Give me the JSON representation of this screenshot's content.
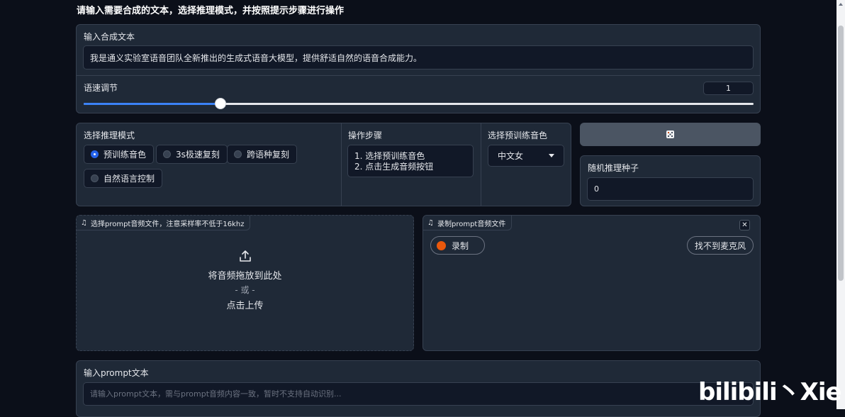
{
  "page": {
    "heading": "请输入需要合成的文本，选择推理模式，并按照提示步骤进行操作"
  },
  "synth_text": {
    "label": "输入合成文本",
    "value": "我是通义实验室语音团队全新推出的生成式语音大模型，提供舒适自然的语音合成能力。"
  },
  "speed": {
    "label": "语速调节",
    "value": "1",
    "fill_fraction": 0.204
  },
  "mode": {
    "label": "选择推理模式",
    "options": [
      "预训练音色",
      "3s极速复刻",
      "跨语种复刻",
      "自然语言控制"
    ],
    "selected": "预训练音色"
  },
  "steps": {
    "label": "操作步骤",
    "line1": "1. 选择预训练音色",
    "line2": "2. 点击生成音频按钮"
  },
  "voice": {
    "label": "选择预训练音色",
    "value": "中文女"
  },
  "dice": {
    "icon": "dice-icon"
  },
  "seed": {
    "label": "随机推理种子",
    "value": "0"
  },
  "upload": {
    "tag": "选择prompt音频文件，注意采样率不低于16khz",
    "drop_text": "将音频拖放到此处",
    "or_text": "- 或 -",
    "click_text": "点击上传"
  },
  "record": {
    "tag": "录制prompt音频文件",
    "record_label": "录制",
    "no_mic_label": "找不到麦克风"
  },
  "prompt_text": {
    "label": "输入prompt文本",
    "placeholder": "请输入prompt文本，需与prompt音频内容一致，暂时不支持自动识别..."
  },
  "watermark": {
    "text": "bilibili丶Xie"
  },
  "colors": {
    "accent": "#2563eb",
    "record_dot": "#ea580c",
    "background": "#0b0f19",
    "panel": "#1f2937"
  }
}
